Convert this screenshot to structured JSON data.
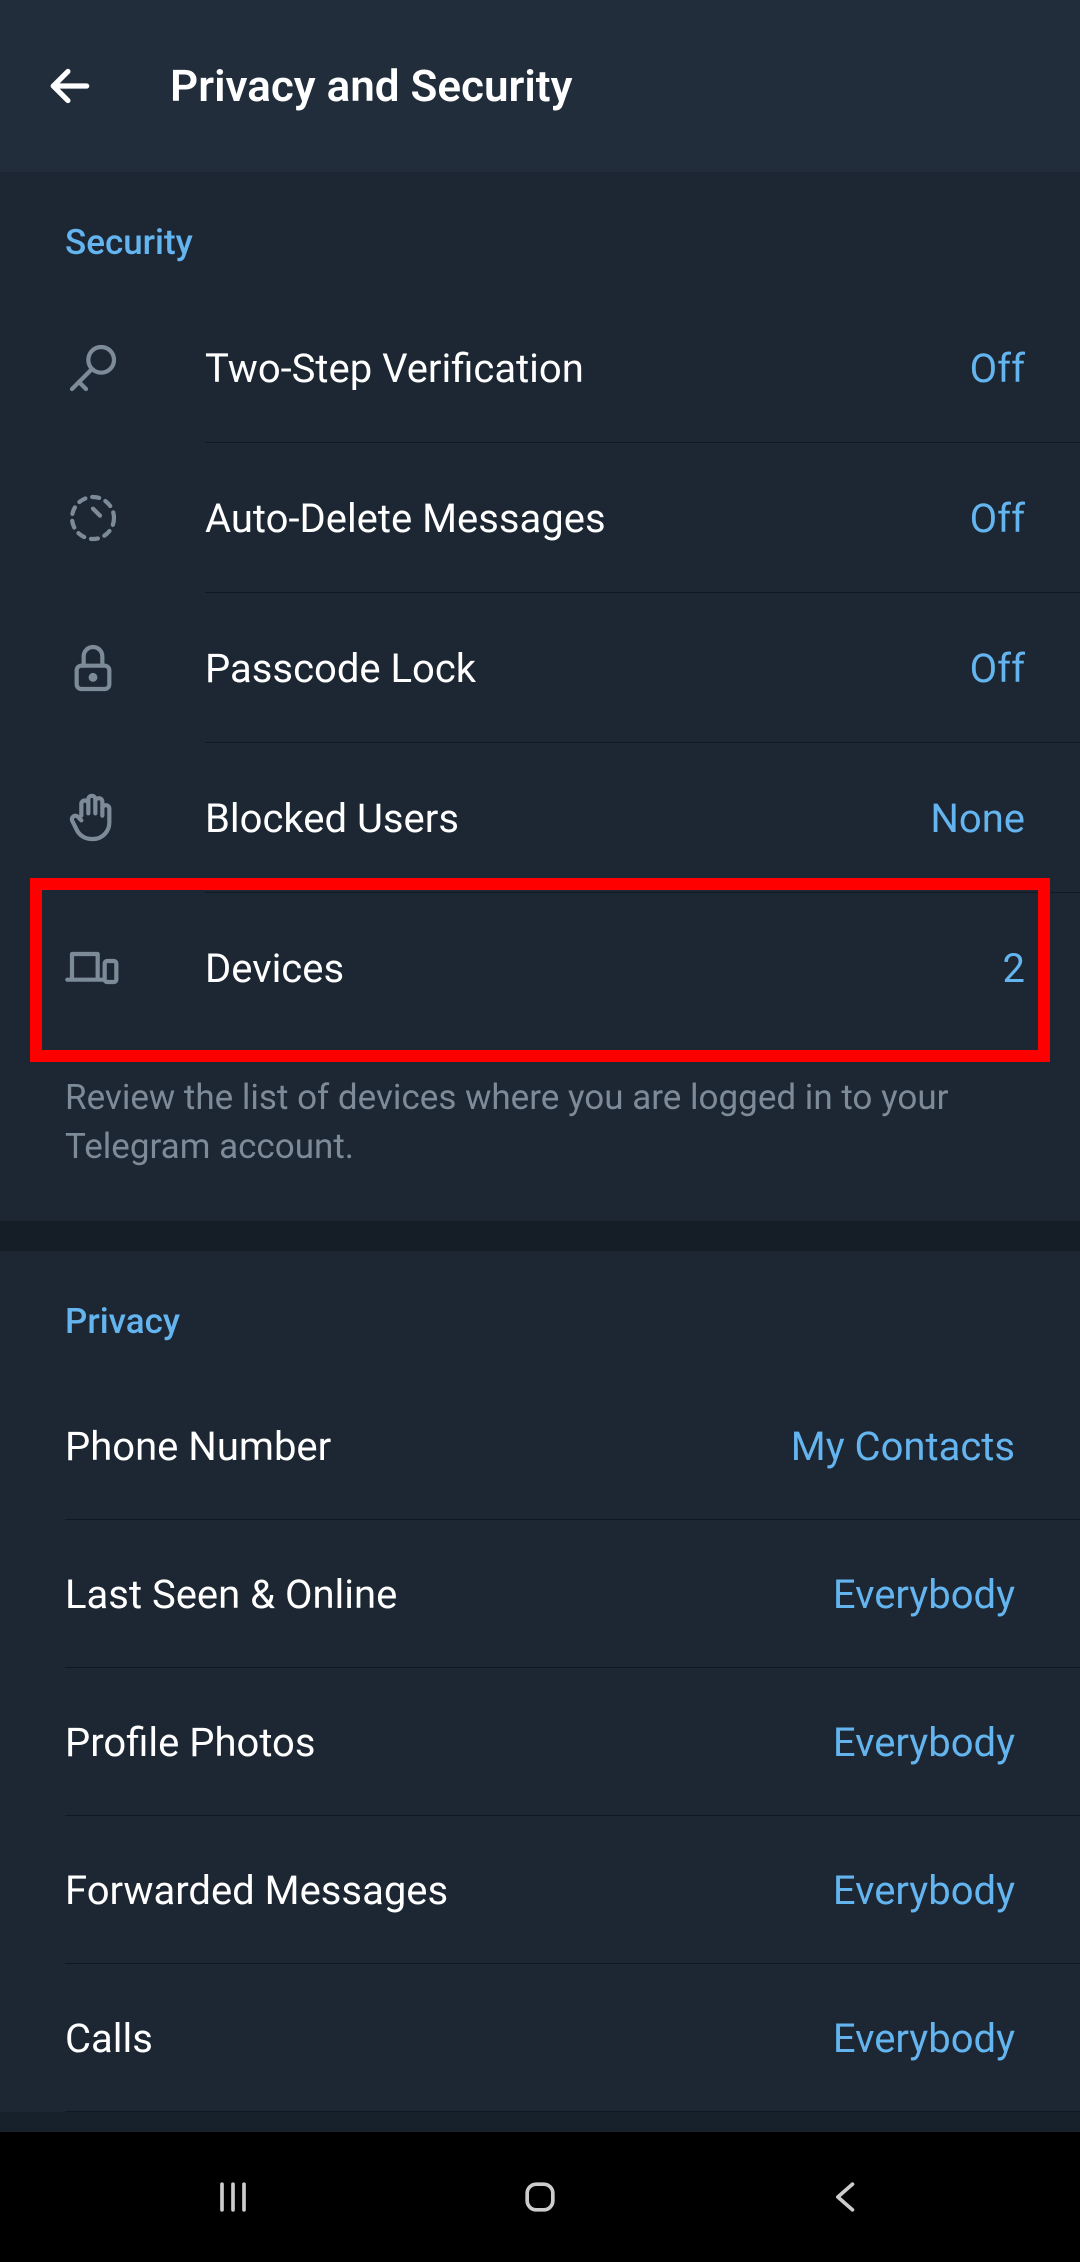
{
  "header": {
    "title": "Privacy and Security"
  },
  "security": {
    "heading": "Security",
    "items": [
      {
        "label": "Two-Step Verification",
        "value": "Off"
      },
      {
        "label": "Auto-Delete Messages",
        "value": "Off"
      },
      {
        "label": "Passcode Lock",
        "value": "Off"
      },
      {
        "label": "Blocked Users",
        "value": "None"
      },
      {
        "label": "Devices",
        "value": "2"
      }
    ],
    "footer": "Review the list of devices where you are logged in to your Telegram account."
  },
  "privacy": {
    "heading": "Privacy",
    "items": [
      {
        "label": "Phone Number",
        "value": "My Contacts"
      },
      {
        "label": "Last Seen & Online",
        "value": "Everybody"
      },
      {
        "label": "Profile Photos",
        "value": "Everybody"
      },
      {
        "label": "Forwarded Messages",
        "value": "Everybody"
      },
      {
        "label": "Calls",
        "value": "Everybody"
      }
    ]
  }
}
